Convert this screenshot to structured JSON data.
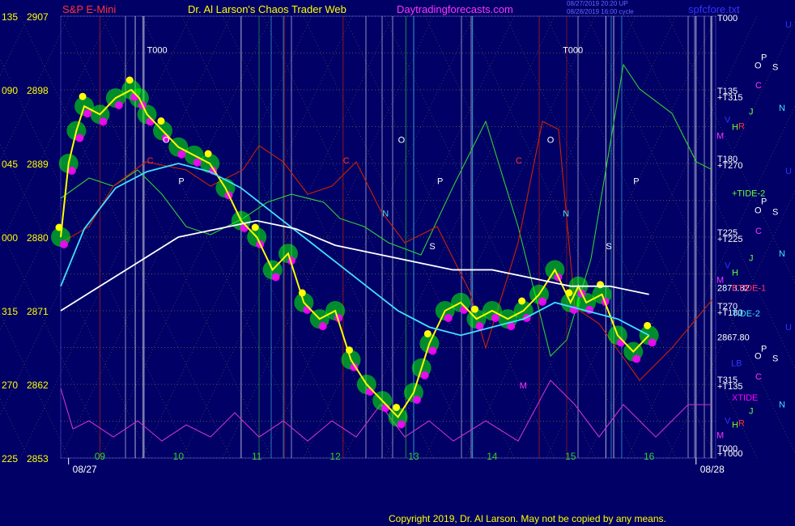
{
  "header": {
    "instrument": "S&P E-Mini",
    "site_title": "Dr. Al Larson's Chaos Trader Web",
    "website": "Daytradingforecasts.com",
    "timestamp_1": "08/27/2019 20:20 UP",
    "timestamp_2": "08/28/2019 16:00 cycle",
    "file_label": "spfcfore.txt"
  },
  "copyright": "Copyright 2019, Dr. Al Larson. May not be copied by any means.",
  "colors": {
    "background": "#000066",
    "price": "#ffff00",
    "ma_fast": "#40e0ff",
    "ma_slow": "#ffffff",
    "energy": "#00ff00",
    "highlight": "#ff00ff",
    "red_line": "#cc2200",
    "green_line": "#33cc33",
    "magenta_line": "#cc33cc",
    "grid": "#cccc44"
  },
  "chart_data": {
    "type": "line",
    "title": "S&P E-Mini",
    "xlabel": "",
    "ylabel": "",
    "ylim": [
      2853,
      2907
    ],
    "xlim": [
      8.5,
      16.85
    ],
    "y_ticks": [
      {
        "value": 2907,
        "angle": "135"
      },
      {
        "value": 2898,
        "angle": "090"
      },
      {
        "value": 2889,
        "angle": "045"
      },
      {
        "value": 2880,
        "angle": "000"
      },
      {
        "value": 2871,
        "angle": "315"
      },
      {
        "value": 2862,
        "angle": "270"
      },
      {
        "value": 2853,
        "angle": "225"
      }
    ],
    "x_ticks": [
      {
        "x": 9,
        "label": "09"
      },
      {
        "x": 10,
        "label": "10"
      },
      {
        "x": 11,
        "label": "11"
      },
      {
        "x": 12,
        "label": "12"
      },
      {
        "x": 13,
        "label": "13"
      },
      {
        "x": 14,
        "label": "14"
      },
      {
        "x": 15,
        "label": "15"
      },
      {
        "x": 16,
        "label": "16"
      }
    ],
    "dates": [
      {
        "x": 8.6,
        "label": "08/27"
      },
      {
        "x": 16.6,
        "label": "08/28"
      }
    ],
    "series": [
      {
        "key": "price",
        "x": [
          8.5,
          8.6,
          8.7,
          8.8,
          9.0,
          9.2,
          9.4,
          9.5,
          9.6,
          9.8,
          10.0,
          10.2,
          10.4,
          10.6,
          10.8,
          11.0,
          11.2,
          11.4,
          11.6,
          11.8,
          12.0,
          12.2,
          12.4,
          12.6,
          12.8,
          13.0,
          13.1,
          13.2,
          13.4,
          13.6,
          13.8,
          14.0,
          14.2,
          14.4,
          14.6,
          14.8,
          15.0,
          15.1,
          15.2,
          15.4,
          15.6,
          15.8,
          16.0
        ],
        "y": [
          2880,
          2889,
          2893,
          2896,
          2895,
          2897,
          2898,
          2897,
          2895,
          2893,
          2891,
          2890,
          2889,
          2886,
          2882,
          2880,
          2876,
          2878,
          2872,
          2870,
          2871,
          2865,
          2862,
          2860,
          2858,
          2861,
          2864,
          2867,
          2871,
          2872,
          2870,
          2871,
          2870,
          2871,
          2873,
          2876,
          2872,
          2874,
          2872,
          2873,
          2868,
          2866,
          2868
        ]
      },
      {
        "key": "ma_fast",
        "x": [
          8.5,
          8.8,
          9.2,
          9.6,
          10.0,
          10.4,
          10.8,
          11.2,
          11.6,
          12.0,
          12.4,
          12.8,
          13.2,
          13.6,
          14.0,
          14.4,
          14.8,
          15.2,
          15.6,
          16.0
        ],
        "y": [
          2874,
          2881,
          2886,
          2888,
          2889,
          2888,
          2886,
          2883,
          2880,
          2877,
          2874,
          2871,
          2869,
          2868,
          2869,
          2870,
          2872,
          2871,
          2870,
          2868
        ]
      },
      {
        "key": "ma_slow",
        "x": [
          8.5,
          9.0,
          9.5,
          10.0,
          10.5,
          11.0,
          11.5,
          12.0,
          12.5,
          13.0,
          13.5,
          14.0,
          14.5,
          15.0,
          15.5,
          16.0
        ],
        "y": [
          2871,
          2874,
          2877,
          2880,
          2881,
          2882,
          2881,
          2879,
          2878,
          2877,
          2876,
          2876,
          2875,
          2874,
          2874,
          2873
        ]
      }
    ],
    "price_labels": [
      {
        "value": 2873.82,
        "label": "2873.82"
      },
      {
        "value": 2867.8,
        "label": "2867.80"
      }
    ],
    "right_labels": [
      {
        "value": 2906.8,
        "label": "T000",
        "color": "#ffffff"
      },
      {
        "value": 2897.9,
        "label": "T135",
        "color": "#ffffff"
      },
      {
        "value": 2897.1,
        "label": "+T315",
        "color": "#ffffff"
      },
      {
        "value": 2889.6,
        "label": "T180",
        "color": "#ffffff"
      },
      {
        "value": 2888.8,
        "label": "+T270",
        "color": "#ffffff"
      },
      {
        "value": 2885.4,
        "label": "+TIDE-2",
        "color": "#66ff33"
      },
      {
        "value": 2880.6,
        "label": "T225",
        "color": "#ffffff"
      },
      {
        "value": 2879.8,
        "label": "+T225",
        "color": "#ffffff"
      },
      {
        "value": 2873.8,
        "label": "ETIDE-1",
        "color": "#ff3366"
      },
      {
        "value": 2871.6,
        "label": "T270",
        "color": "#ffffff"
      },
      {
        "value": 2870.8,
        "label": "+T180",
        "color": "#ffffff"
      },
      {
        "value": 2870.7,
        "label": "TIDE-2",
        "color": "#40e0ff"
      },
      {
        "value": 2862.6,
        "label": "T315",
        "color": "#ffffff"
      },
      {
        "value": 2861.8,
        "label": "+T135",
        "color": "#ffffff"
      },
      {
        "value": 2860.4,
        "label": "XTIDE",
        "color": "#ff00ff"
      },
      {
        "value": 2854.2,
        "label": "T000",
        "color": "#ffffff"
      },
      {
        "value": 2853.6,
        "label": "+T000",
        "color": "#ffffff"
      }
    ],
    "planet_glyphs": [
      {
        "value": 2906.0,
        "label": "U",
        "color": "#3333ff"
      },
      {
        "value": 2902.0,
        "label": "P",
        "color": "#ffffff"
      },
      {
        "value": 2901.0,
        "label": "O",
        "color": "#ffffff"
      },
      {
        "value": 2900.8,
        "label": "S",
        "color": "#ffffff"
      },
      {
        "value": 2898.6,
        "label": "C",
        "color": "#ff33ff"
      },
      {
        "value": 2895.8,
        "label": "N",
        "color": "#40e0ff"
      },
      {
        "value": 2895.4,
        "label": "J",
        "color": "#66ff33"
      },
      {
        "value": 2894.4,
        "label": "V",
        "color": "#3333ff"
      },
      {
        "value": 2893.5,
        "label": "H",
        "color": "#66ff33"
      },
      {
        "value": 2893.6,
        "label": "R",
        "color": "#ff3333"
      },
      {
        "value": 2892.4,
        "label": "M",
        "color": "#ff33ff"
      },
      {
        "value": 2888.1,
        "label": "U",
        "color": "#3333ff"
      },
      {
        "value": 2884.4,
        "label": "P",
        "color": "#ffffff"
      },
      {
        "value": 2883.3,
        "label": "O",
        "color": "#ffffff"
      },
      {
        "value": 2883.1,
        "label": "S",
        "color": "#ffffff"
      },
      {
        "value": 2880.8,
        "label": "C",
        "color": "#ff33ff"
      },
      {
        "value": 2878.0,
        "label": "N",
        "color": "#40e0ff"
      },
      {
        "value": 2877.5,
        "label": "J",
        "color": "#66ff33"
      },
      {
        "value": 2876.6,
        "label": "V",
        "color": "#3333ff"
      },
      {
        "value": 2875.7,
        "label": "H",
        "color": "#66ff33"
      },
      {
        "value": 2874.8,
        "label": "M",
        "color": "#ff33ff"
      },
      {
        "value": 2869.0,
        "label": "U",
        "color": "#3333ff"
      },
      {
        "value": 2866.4,
        "label": "P",
        "color": "#ffffff"
      },
      {
        "value": 2865.5,
        "label": "O",
        "color": "#ffffff"
      },
      {
        "value": 2865.2,
        "label": "S",
        "color": "#ffffff"
      },
      {
        "value": 2864.6,
        "label": "LB",
        "color": "#3333ff"
      },
      {
        "value": 2863.0,
        "label": "C",
        "color": "#ff33ff"
      },
      {
        "value": 2859.6,
        "label": "N",
        "color": "#40e0ff"
      },
      {
        "value": 2858.8,
        "label": "J",
        "color": "#66ff33"
      },
      {
        "value": 2857.6,
        "label": "V",
        "color": "#3333ff"
      },
      {
        "value": 2857.1,
        "label": "H",
        "color": "#66ff33"
      },
      {
        "value": 2857.3,
        "label": "R",
        "color": "#ff3333"
      },
      {
        "value": 2855.8,
        "label": "M",
        "color": "#ff33ff"
      }
    ],
    "chart_annotations": [
      {
        "x": 9.6,
        "y": 2902.5,
        "label": "T000",
        "color": "#ffffff"
      },
      {
        "x": 14.9,
        "y": 2902.5,
        "label": "T000",
        "color": "#ffffff"
      },
      {
        "x": 9.8,
        "y": 2891.5,
        "label": "O",
        "color": "#ffffff"
      },
      {
        "x": 12.8,
        "y": 2891.5,
        "label": "O",
        "color": "#ffffff"
      },
      {
        "x": 14.7,
        "y": 2891.5,
        "label": "O",
        "color": "#ffffff"
      },
      {
        "x": 10.0,
        "y": 2886.5,
        "label": "P",
        "color": "#ffffff"
      },
      {
        "x": 13.3,
        "y": 2886.5,
        "label": "P",
        "color": "#ffffff"
      },
      {
        "x": 15.8,
        "y": 2886.5,
        "label": "P",
        "color": "#ffffff"
      },
      {
        "x": 9.6,
        "y": 2889.0,
        "label": "C",
        "color": "#ff3333"
      },
      {
        "x": 12.1,
        "y": 2889.0,
        "label": "C",
        "color": "#ff3333"
      },
      {
        "x": 14.3,
        "y": 2889.0,
        "label": "C",
        "color": "#ff3333"
      },
      {
        "x": 12.6,
        "y": 2882.5,
        "label": "N",
        "color": "#40e0ff"
      },
      {
        "x": 14.9,
        "y": 2882.5,
        "label": "N",
        "color": "#40e0ff"
      },
      {
        "x": 15.45,
        "y": 2878.5,
        "label": "S",
        "color": "#ffffff"
      },
      {
        "x": 13.2,
        "y": 2878.5,
        "label": "S",
        "color": "#ffffff"
      },
      {
        "x": 14.35,
        "y": 2861.5,
        "label": "M",
        "color": "#ff33ff"
      }
    ]
  }
}
